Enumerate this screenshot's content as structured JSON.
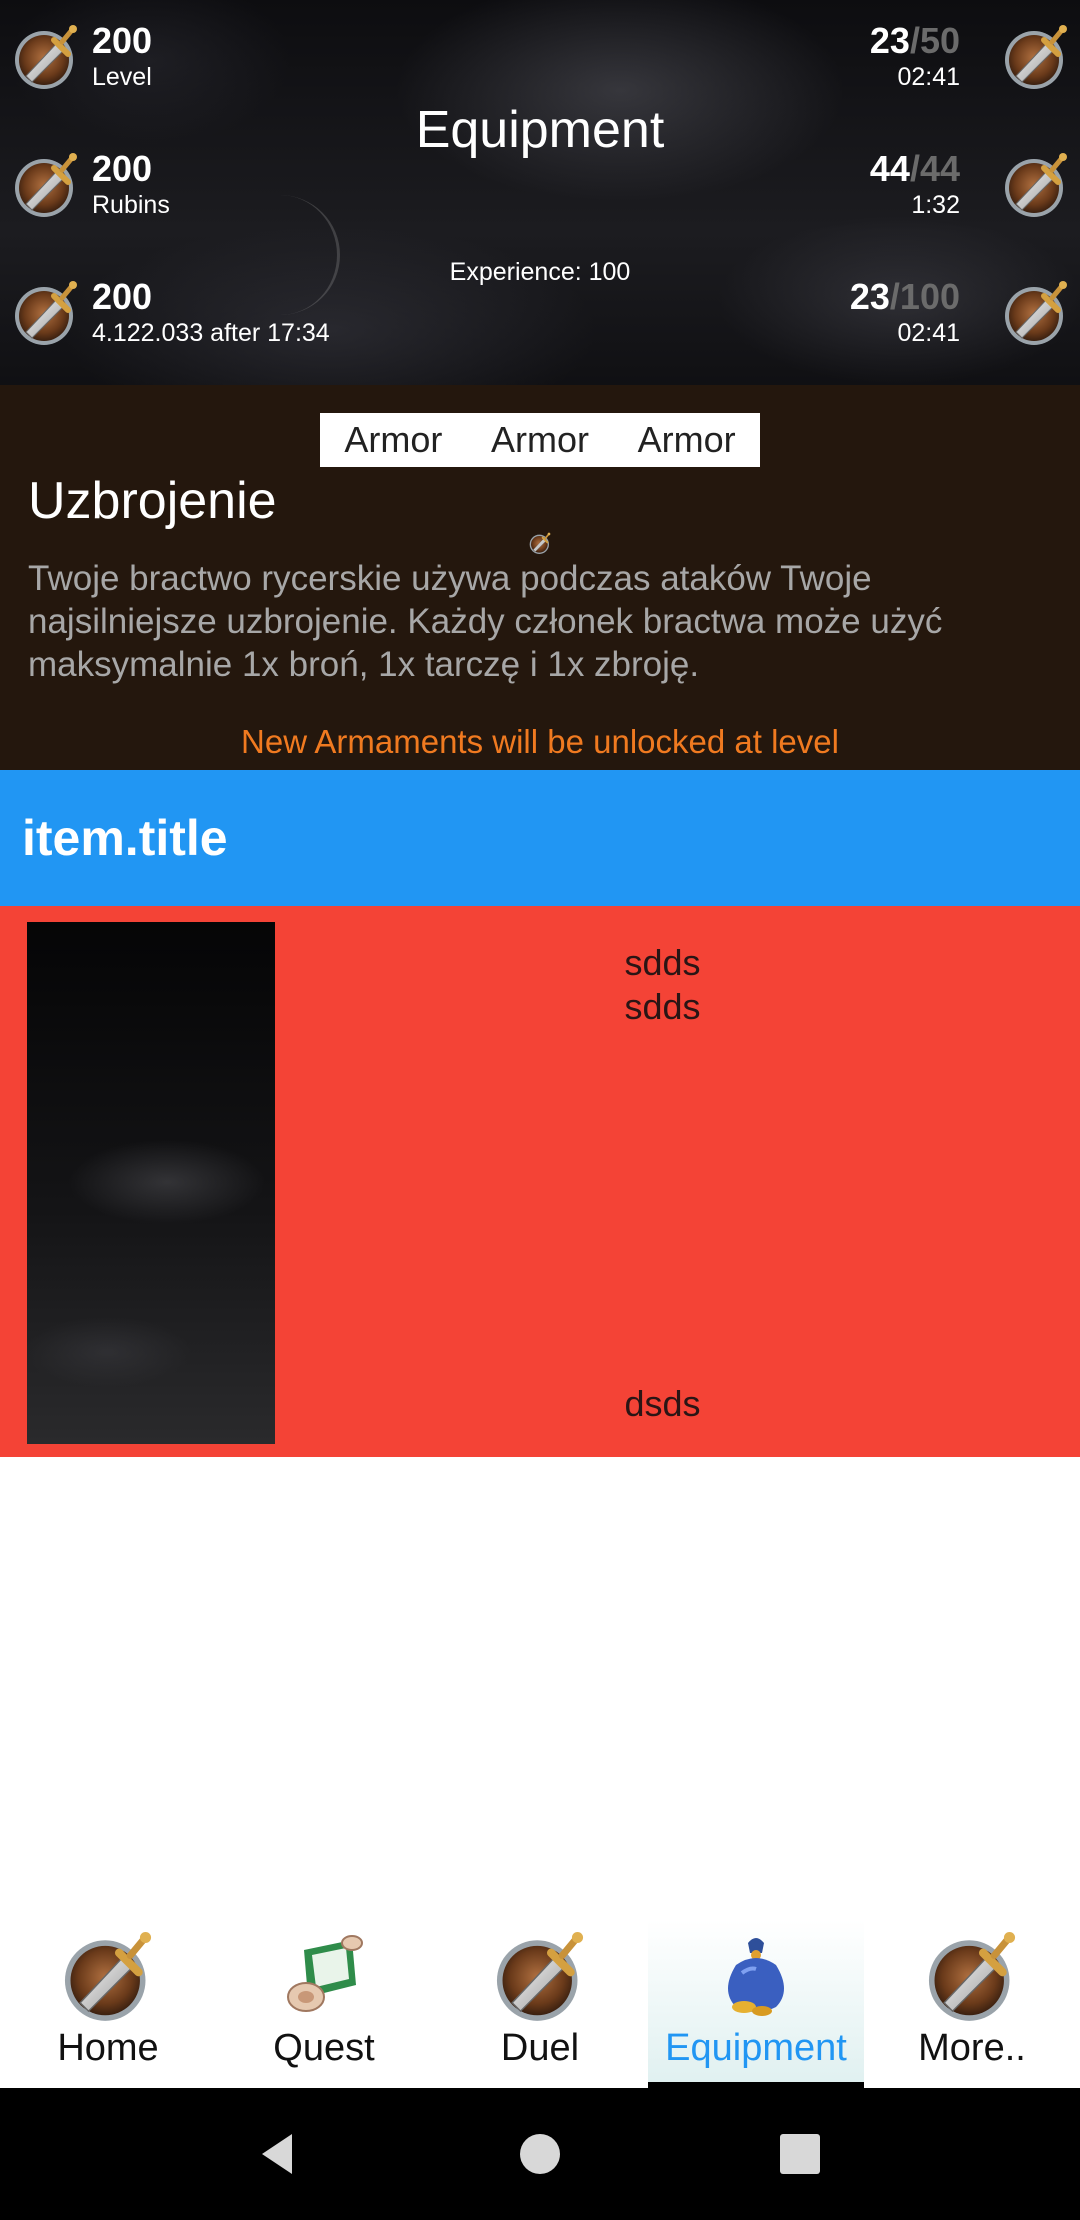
{
  "header": {
    "title": "Equipment",
    "experience": "Experience: 100",
    "left_stats": [
      {
        "value": "200",
        "label": "Level",
        "icon": "sword-shield-icon"
      },
      {
        "value": "200",
        "label": "Rubins",
        "icon": "sword-shield-icon"
      },
      {
        "value": "200",
        "label": "4.122.033 after 17:34",
        "icon": "sword-shield-icon"
      }
    ],
    "right_stats": [
      {
        "current": "23",
        "max": "/50",
        "timer": "02:41",
        "icon": "sword-shield-icon"
      },
      {
        "current": "44",
        "max": "/44",
        "timer": "1:32",
        "icon": "sword-shield-icon"
      },
      {
        "current": "23",
        "max": "/100",
        "timer": "02:41",
        "icon": "sword-shield-icon"
      }
    ]
  },
  "info": {
    "tabs": [
      "Armor",
      "Armor",
      "Armor"
    ],
    "title": "Uzbrojenie",
    "description": "Twoje bractwo rycerskie używa podczas ataków Twoje najsilniejsze uzbrojenie. Każdy członek bractwa może użyć maksymalnie 1x broń, 1x tarczę i 1x zbroję.",
    "unlock_text": "New Armaments will be unlocked at level"
  },
  "item": {
    "title": "item.title",
    "line1": "sdds",
    "line2": "sdds",
    "line3": "dsds"
  },
  "bottom_nav": {
    "items": [
      {
        "label": "Home",
        "icon": "sword-shield-icon"
      },
      {
        "label": "Quest",
        "icon": "scroll-icon"
      },
      {
        "label": "Duel",
        "icon": "sword-shield-icon"
      },
      {
        "label": "Equipment",
        "icon": "money-bag-icon"
      },
      {
        "label": "More..",
        "icon": "sword-shield-icon"
      }
    ],
    "active": "Equipment"
  },
  "colors": {
    "item_header": "#2196f3",
    "item_body": "#f44336",
    "info_bg": "#24170d",
    "unlock_text": "#f07a20",
    "active_nav": "#2196f3"
  }
}
